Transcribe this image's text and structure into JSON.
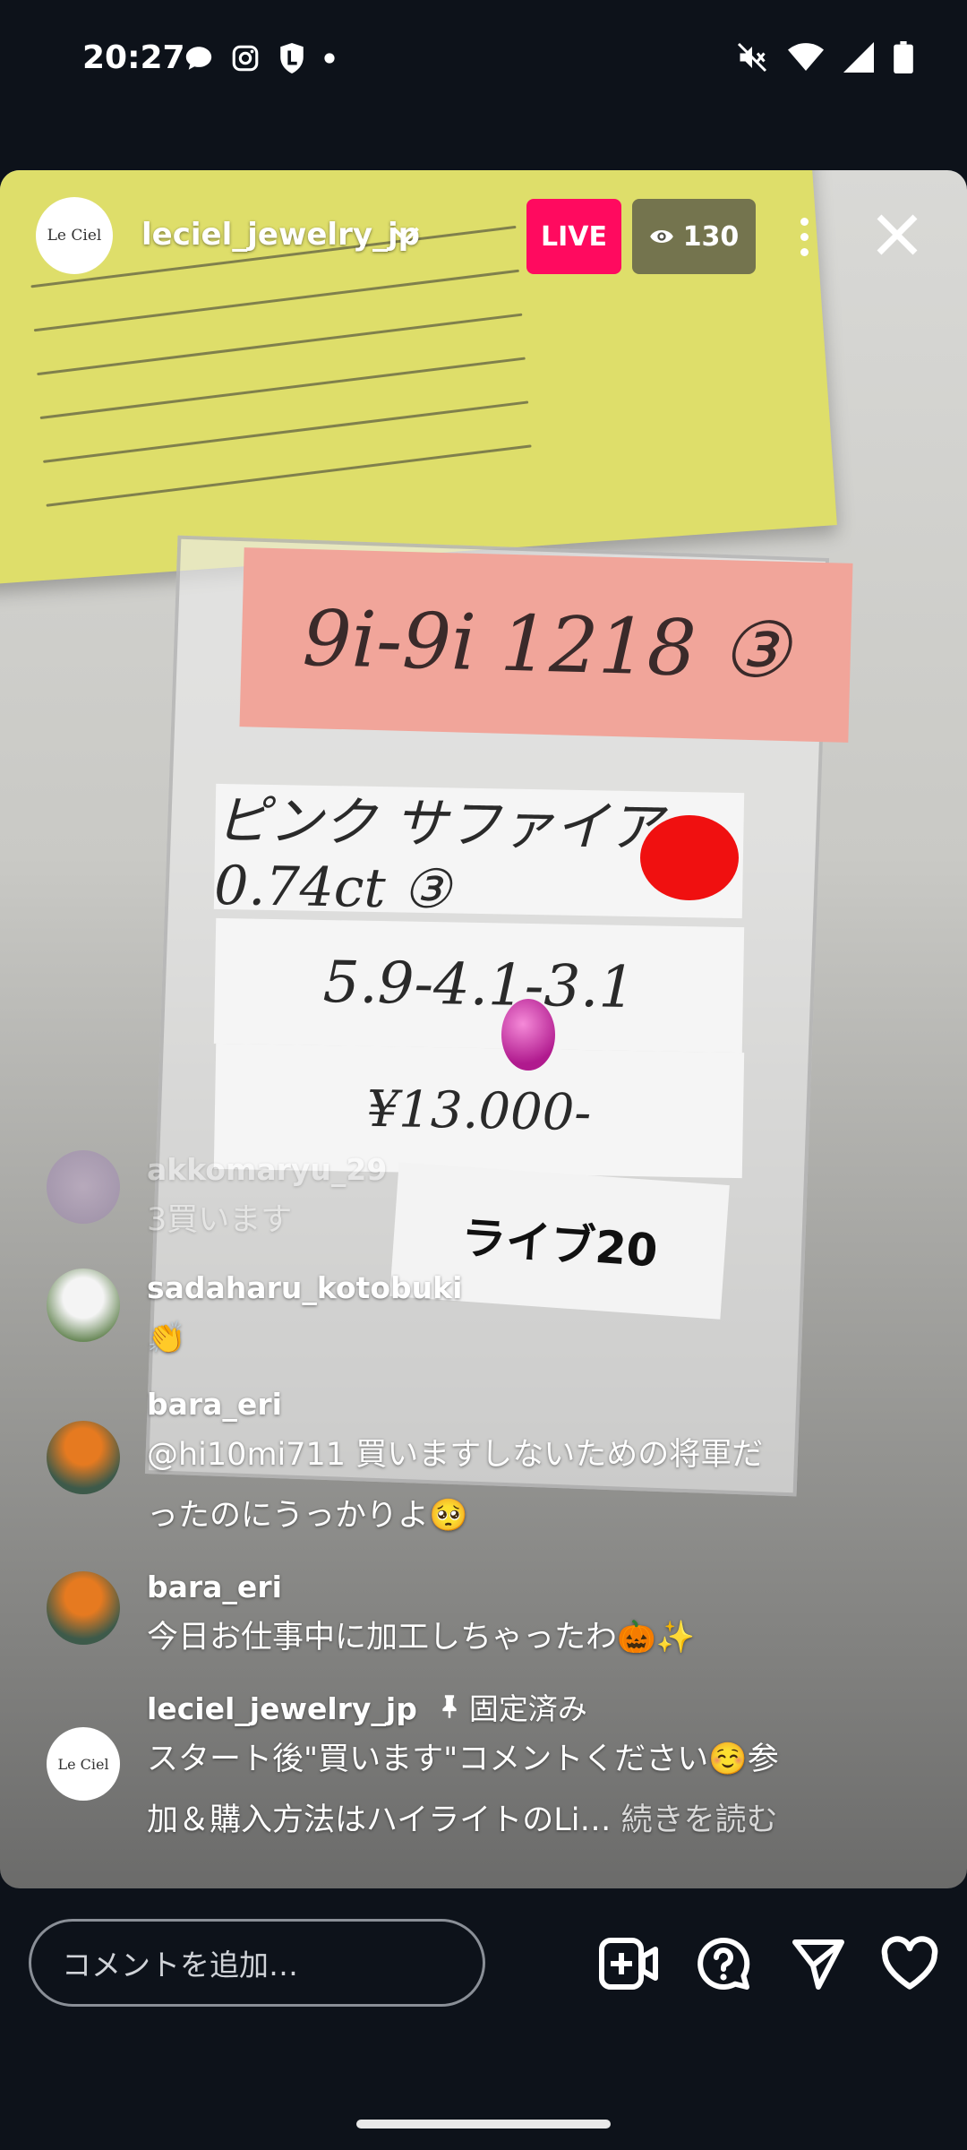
{
  "status_bar": {
    "time": "20:27"
  },
  "header": {
    "username": "leciel_jewelry_jp",
    "avatar_text": "Le Ciel",
    "live_label": "LIVE",
    "viewer_count": "130"
  },
  "video": {
    "tag_text": "9i-9i 1218 ③",
    "card1": "ピンク サファイア 0.74ct ③",
    "card2": "5.9-4.1-3.1",
    "card3": "¥13.000-",
    "live_tag": "ライブ20"
  },
  "comments": [
    {
      "user": "akkomaryu_29",
      "text": "3買います"
    },
    {
      "user": "sadaharu_kotobuki",
      "text": "👏"
    },
    {
      "user": "bara_eri",
      "text_line1": "@hi10mi711 買いますしないための将軍だ",
      "text_line2": "ったのにうっかりよ🥺"
    },
    {
      "user": "bara_eri",
      "text": "今日お仕事中に加工しちゃったわ🎃✨"
    },
    {
      "user": "leciel_jewelry_jp",
      "pinned_label": "固定済み",
      "avatar_text": "Le Ciel",
      "text_line1": "スタート後\"買います\"コメントください☺️参",
      "text_line2": "加＆購入方法はハイライトのLi…",
      "more": "続きを読む"
    }
  ],
  "bottom_bar": {
    "comment_placeholder": "コメントを追加…"
  }
}
